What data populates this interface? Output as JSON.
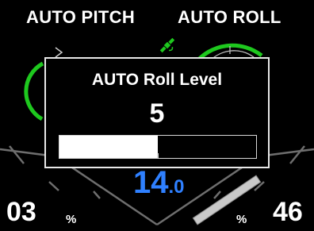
{
  "header": {
    "left_label": "AUTO PITCH",
    "right_label": "AUTO ROLL"
  },
  "popup": {
    "title": "AUTO Roll Level",
    "value": "5",
    "level_fraction": 0.5
  },
  "speed": {
    "integer": "14",
    "decimal": ".0"
  },
  "bottom": {
    "left_value": "03",
    "left_unit": "%",
    "right_value": "46",
    "right_unit": "%"
  },
  "icons": [
    "satellite-icon"
  ],
  "colors": {
    "background": "#000000",
    "accent_green": "#1ec81e",
    "speed_blue": "#2f80ff",
    "scale_grey": "#7a7a7a",
    "popup_border": "#e8e8e8"
  }
}
